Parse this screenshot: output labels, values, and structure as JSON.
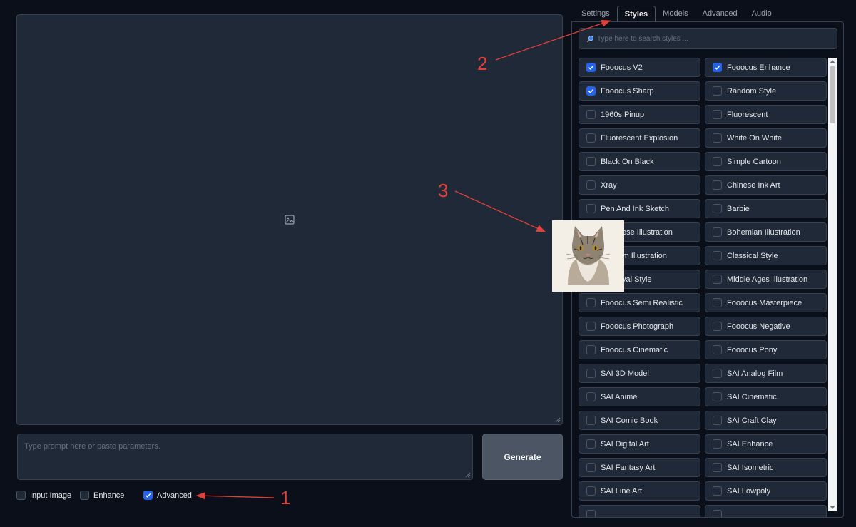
{
  "main": {
    "prompt_placeholder": "Type prompt here or paste parameters.",
    "generate_label": "Generate",
    "options": [
      {
        "label": "Input Image",
        "checked": false
      },
      {
        "label": "Enhance",
        "checked": false
      },
      {
        "label": "Advanced",
        "checked": true
      }
    ]
  },
  "tabs": [
    {
      "label": "Settings",
      "active": false
    },
    {
      "label": "Styles",
      "active": true
    },
    {
      "label": "Models",
      "active": false
    },
    {
      "label": "Advanced",
      "active": false
    },
    {
      "label": "Audio",
      "active": false
    }
  ],
  "styles": {
    "search_placeholder": "Type here to search styles ...",
    "items": [
      {
        "label": "Fooocus V2",
        "checked": true
      },
      {
        "label": "Fooocus Enhance",
        "checked": true
      },
      {
        "label": "Fooocus Sharp",
        "checked": true
      },
      {
        "label": "Random Style",
        "checked": false
      },
      {
        "label": "1960s Pinup",
        "checked": false
      },
      {
        "label": "Fluorescent",
        "checked": false
      },
      {
        "label": "Fluorescent Explosion",
        "checked": false
      },
      {
        "label": "White On White",
        "checked": false
      },
      {
        "label": "Black On Black",
        "checked": false
      },
      {
        "label": "Simple Cartoon",
        "checked": false
      },
      {
        "label": "Xray",
        "checked": false
      },
      {
        "label": "Chinese Ink Art",
        "checked": false
      },
      {
        "label": "Pen And Ink Sketch",
        "checked": false
      },
      {
        "label": "Barbie",
        "checked": false
      },
      {
        "label": "Japanese Illustration",
        "checked": false
      },
      {
        "label": "Bohemian Illustration",
        "checked": false
      },
      {
        "label": "Realism Illustration",
        "checked": false
      },
      {
        "label": "Classical Style",
        "checked": false
      },
      {
        "label": "Medieval Style",
        "checked": false
      },
      {
        "label": "Middle Ages Illustration",
        "checked": false
      },
      {
        "label": "Fooocus Semi Realistic",
        "checked": false
      },
      {
        "label": "Fooocus Masterpiece",
        "checked": false
      },
      {
        "label": "Fooocus Photograph",
        "checked": false
      },
      {
        "label": "Fooocus Negative",
        "checked": false
      },
      {
        "label": "Fooocus Cinematic",
        "checked": false
      },
      {
        "label": "Fooocus Pony",
        "checked": false
      },
      {
        "label": "SAI 3D Model",
        "checked": false
      },
      {
        "label": "SAI Analog Film",
        "checked": false
      },
      {
        "label": "SAI Anime",
        "checked": false
      },
      {
        "label": "SAI Cinematic",
        "checked": false
      },
      {
        "label": "SAI Comic Book",
        "checked": false
      },
      {
        "label": "SAI Craft Clay",
        "checked": false
      },
      {
        "label": "SAI Digital Art",
        "checked": false
      },
      {
        "label": "SAI Enhance",
        "checked": false
      },
      {
        "label": "SAI Fantasy Art",
        "checked": false
      },
      {
        "label": "SAI Isometric",
        "checked": false
      },
      {
        "label": "SAI Line Art",
        "checked": false
      },
      {
        "label": "SAI Lowpoly",
        "checked": false
      },
      {
        "label": "",
        "checked": false
      },
      {
        "label": "",
        "checked": false
      }
    ]
  },
  "annotations": [
    "1",
    "2",
    "3"
  ],
  "colors": {
    "accent": "#2563eb",
    "annotation": "#e0403a",
    "background": "#0b0f19",
    "surface": "#1f2937"
  }
}
